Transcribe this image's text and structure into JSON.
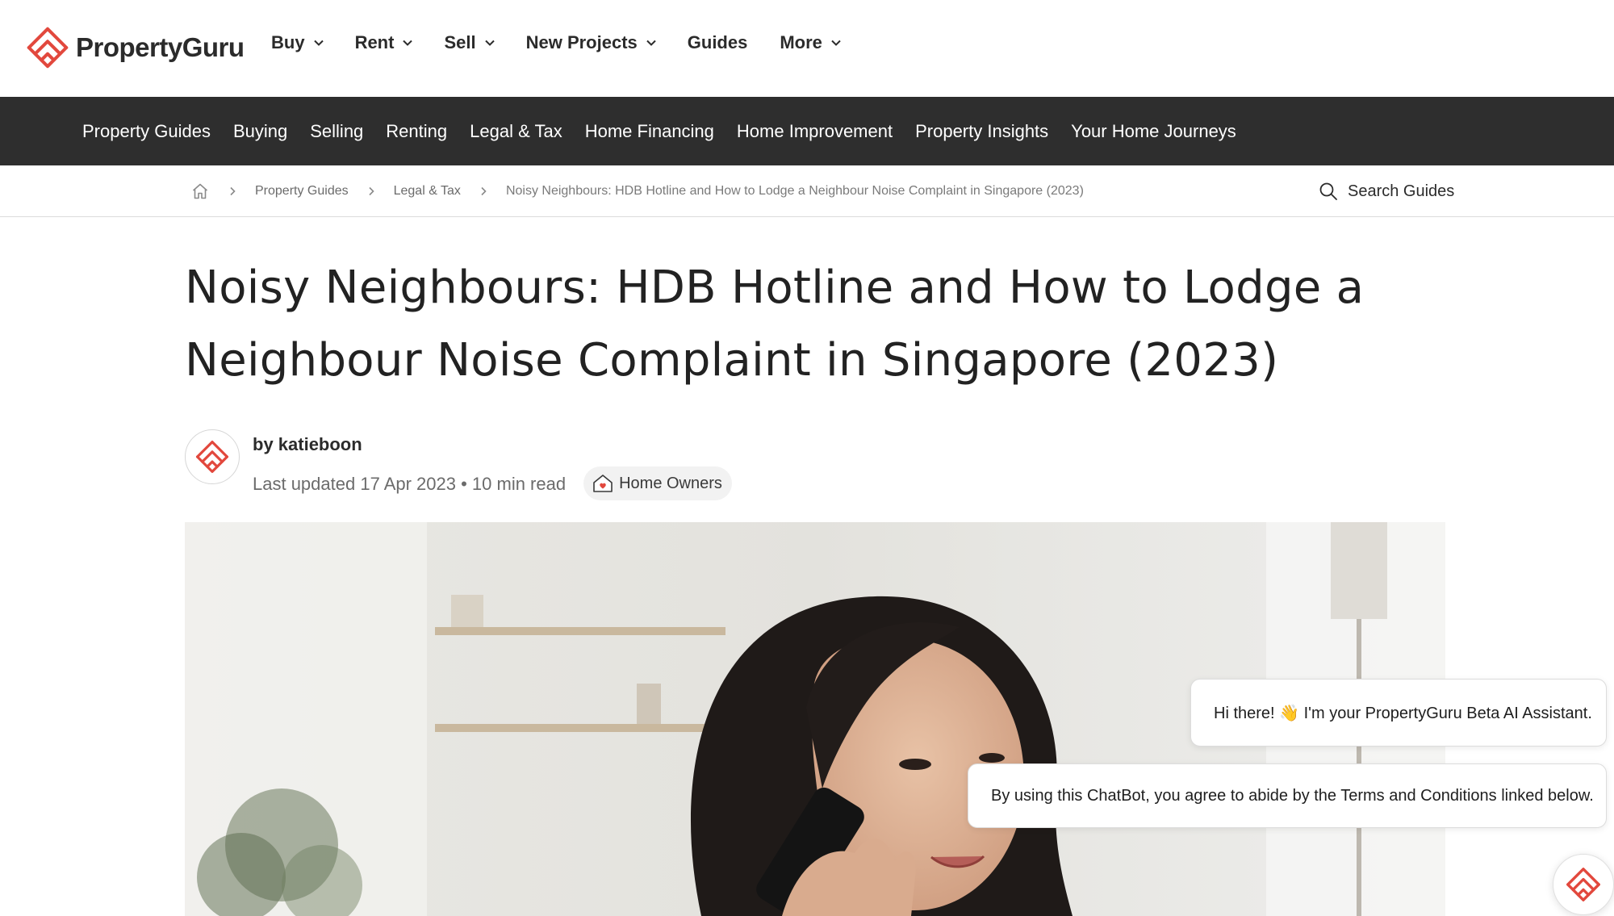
{
  "brand": {
    "name": "PropertyGuru",
    "color": "#e2483d"
  },
  "topnav": [
    {
      "label": "Buy",
      "dropdown": true
    },
    {
      "label": "Rent",
      "dropdown": true
    },
    {
      "label": "Sell",
      "dropdown": true
    },
    {
      "label": "New Projects",
      "dropdown": true
    },
    {
      "label": "Guides",
      "dropdown": false
    },
    {
      "label": "More",
      "dropdown": true
    }
  ],
  "subnav": [
    "Property Guides",
    "Buying",
    "Selling",
    "Renting",
    "Legal & Tax",
    "Home Financing",
    "Home Improvement",
    "Property Insights",
    "Your Home Journeys"
  ],
  "breadcrumb": {
    "home_icon": "home-icon",
    "items": [
      "Property Guides",
      "Legal & Tax",
      "Noisy Neighbours: HDB Hotline and How to Lodge a Neighbour Noise Complaint in Singapore (2023)"
    ]
  },
  "search": {
    "label": "Search Guides",
    "icon": "search-icon"
  },
  "article": {
    "title_line1": "Noisy Neighbours: HDB Hotline and How to Lodge a",
    "title_line2": "Neighbour Noise Complaint in Singapore (2023)",
    "byline": "by katieboon",
    "updated": "Last updated 17 Apr 2023 • 10 min read",
    "tag": "Home Owners"
  },
  "chat": {
    "greeting": "Hi there! 👋 I'm your PropertyGuru Beta AI Assistant.",
    "terms": "By using this ChatBot, you agree to abide by the Terms and Conditions linked below."
  },
  "colors": {
    "subnav_bg": "#2e2e2e",
    "accent": "#e2483d"
  }
}
